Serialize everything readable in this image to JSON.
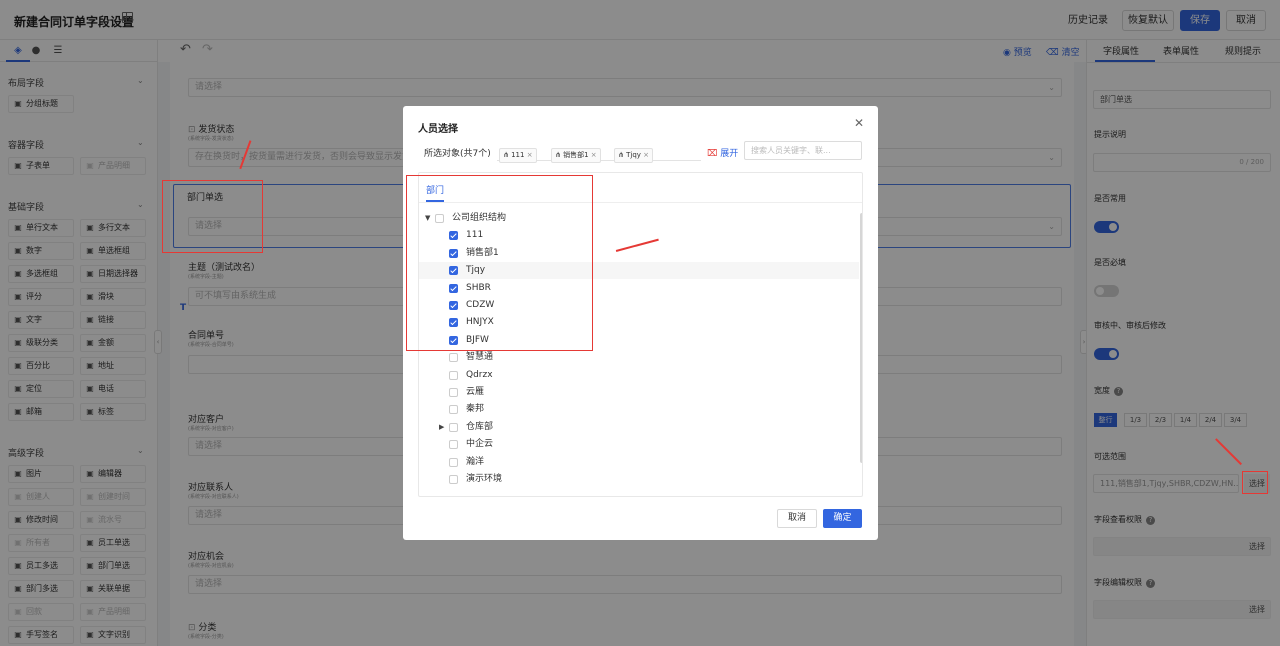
{
  "header": {
    "title": "新建合同订单字段设置",
    "history": "历史记录",
    "restore_default": "恢复默认",
    "save": "保存",
    "cancel": "取消"
  },
  "left_panel": {
    "sections": [
      {
        "title": "布局字段",
        "items": [
          {
            "label": "分组标题",
            "icon": "group-icon",
            "disabled": false
          }
        ]
      },
      {
        "title": "容器字段",
        "items": [
          {
            "label": "子表单",
            "icon": "table-icon",
            "disabled": false
          },
          {
            "label": "产品明细",
            "icon": "product-icon",
            "disabled": true
          }
        ]
      },
      {
        "title": "基础字段",
        "items": [
          {
            "label": "单行文本",
            "icon": "input-icon",
            "disabled": false
          },
          {
            "label": "多行文本",
            "icon": "textarea-icon",
            "disabled": false
          },
          {
            "label": "数字",
            "icon": "number-icon",
            "disabled": false
          },
          {
            "label": "单选框组",
            "icon": "radio-icon",
            "disabled": false
          },
          {
            "label": "多选框组",
            "icon": "checkbox-icon",
            "disabled": false
          },
          {
            "label": "日期选择器",
            "icon": "calendar-icon",
            "disabled": false
          },
          {
            "label": "评分",
            "icon": "star-icon",
            "disabled": false
          },
          {
            "label": "滑块",
            "icon": "slider-icon",
            "disabled": false
          },
          {
            "label": "文字",
            "icon": "text-icon",
            "disabled": false
          },
          {
            "label": "链接",
            "icon": "link-icon",
            "disabled": false
          },
          {
            "label": "级联分类",
            "icon": "cascade-icon",
            "disabled": false
          },
          {
            "label": "金额",
            "icon": "money-icon",
            "disabled": false
          },
          {
            "label": "百分比",
            "icon": "percent-icon",
            "disabled": false
          },
          {
            "label": "地址",
            "icon": "address-icon",
            "disabled": false
          },
          {
            "label": "定位",
            "icon": "location-icon",
            "disabled": false
          },
          {
            "label": "电话",
            "icon": "phone-icon",
            "disabled": false
          },
          {
            "label": "邮箱",
            "icon": "mail-icon",
            "disabled": false
          },
          {
            "label": "标签",
            "icon": "tag-icon",
            "disabled": false
          }
        ]
      },
      {
        "title": "高级字段",
        "items": [
          {
            "label": "图片",
            "icon": "image-icon",
            "disabled": false
          },
          {
            "label": "编辑器",
            "icon": "editor-icon",
            "disabled": false
          },
          {
            "label": "创建人",
            "icon": "creator-icon",
            "disabled": true
          },
          {
            "label": "创建时间",
            "icon": "clock-icon",
            "disabled": true
          },
          {
            "label": "修改时间",
            "icon": "clock-icon",
            "disabled": false
          },
          {
            "label": "流水号",
            "icon": "serial-icon",
            "disabled": true
          },
          {
            "label": "所有者",
            "icon": "owner-icon",
            "disabled": true
          },
          {
            "label": "员工单选",
            "icon": "user-icon",
            "disabled": false
          },
          {
            "label": "员工多选",
            "icon": "users-icon",
            "disabled": false
          },
          {
            "label": "部门单选",
            "icon": "dept-icon",
            "disabled": false
          },
          {
            "label": "部门多选",
            "icon": "dept-icon",
            "disabled": false
          },
          {
            "label": "关联单据",
            "icon": "relation-icon",
            "disabled": false
          },
          {
            "label": "回款",
            "icon": "payment-icon",
            "disabled": true
          },
          {
            "label": "产品明细",
            "icon": "product-icon",
            "disabled": true
          },
          {
            "label": "手写签名",
            "icon": "sign-icon",
            "disabled": false
          },
          {
            "label": "文字识别",
            "icon": "ocr-icon",
            "disabled": false
          }
        ]
      }
    ]
  },
  "toolbar": {
    "preview": "预览",
    "clear": "清空"
  },
  "canvas": {
    "top_placeholder": "请选择",
    "fields": [
      {
        "label": "发货状态",
        "sub": "(系统字段-发货状态)",
        "placeholder": "存在换货时，按货量需进行发货，否则会导致显示发货"
      },
      {
        "label": "部门单选",
        "sub": "",
        "placeholder": "请选择"
      },
      {
        "label": "主题（测试改名）",
        "sub": "(系统字段-主题)",
        "placeholder": "可不填写由系统生成"
      },
      {
        "label": "合同单号",
        "sub": "(系统字段-合同单号)",
        "placeholder": ""
      },
      {
        "label": "对应客户",
        "sub": "(系统字段-对应客户)",
        "placeholder": "请选择"
      },
      {
        "label": "对应联系人",
        "sub": "(系统字段-对应联系人)",
        "placeholder": "请选择"
      },
      {
        "label": "对应机会",
        "sub": "(系统字段-对应机会)",
        "placeholder": "请选择"
      },
      {
        "label": "分类",
        "sub": "(系统字段-分类)",
        "placeholder": ""
      }
    ]
  },
  "right_panel": {
    "tabs": [
      "字段属性",
      "表单属性",
      "规则提示"
    ],
    "name_value": "部门单选",
    "hint_label": "提示说明",
    "hint_count": "0 / 200",
    "common_label": "是否常用",
    "required_label": "是否必填",
    "edit_label": "审核中、审核后修改",
    "width_label": "宽度",
    "width_options": [
      "整行",
      "1/3",
      "2/3",
      "1/4",
      "2/4",
      "3/4"
    ],
    "range_label": "可选范围",
    "range_value": "111,销售部1,Tjqy,SHBR,CDZW,HN...",
    "select_btn": "选择",
    "view_perm_label": "字段查看权限",
    "edit_perm_label": "字段编辑权限",
    "accent": "#3366e0"
  },
  "modal": {
    "title": "人员选择",
    "selected_label": "所选对象(共7个)",
    "tags": [
      "111",
      "销售部1",
      "Tjqy"
    ],
    "expand": "展开",
    "search_placeholder": "搜索人员关键字、联...",
    "tab": "部门",
    "tree": [
      {
        "label": "公司组织结构",
        "checked": false,
        "level": 0,
        "arrow": "down"
      },
      {
        "label": "111",
        "checked": true,
        "level": 1,
        "arrow": ""
      },
      {
        "label": "销售部1",
        "checked": true,
        "level": 1,
        "arrow": ""
      },
      {
        "label": "Tjqy",
        "checked": true,
        "level": 1,
        "arrow": ""
      },
      {
        "label": "SHBR",
        "checked": true,
        "level": 1,
        "arrow": ""
      },
      {
        "label": "CDZW",
        "checked": true,
        "level": 1,
        "arrow": ""
      },
      {
        "label": "HNJYX",
        "checked": true,
        "level": 1,
        "arrow": ""
      },
      {
        "label": "BJFW",
        "checked": true,
        "level": 1,
        "arrow": ""
      },
      {
        "label": "智慧通",
        "checked": false,
        "level": 1,
        "arrow": ""
      },
      {
        "label": "Qdrzx",
        "checked": false,
        "level": 1,
        "arrow": ""
      },
      {
        "label": "云雁",
        "checked": false,
        "level": 1,
        "arrow": ""
      },
      {
        "label": "秦邦",
        "checked": false,
        "level": 1,
        "arrow": ""
      },
      {
        "label": "仓库部",
        "checked": false,
        "level": 1,
        "arrow": "right"
      },
      {
        "label": "中企云",
        "checked": false,
        "level": 1,
        "arrow": ""
      },
      {
        "label": "瀚洋",
        "checked": false,
        "level": 1,
        "arrow": ""
      },
      {
        "label": "演示环境",
        "checked": false,
        "level": 1,
        "arrow": ""
      }
    ],
    "cancel": "取消",
    "confirm": "确定"
  }
}
